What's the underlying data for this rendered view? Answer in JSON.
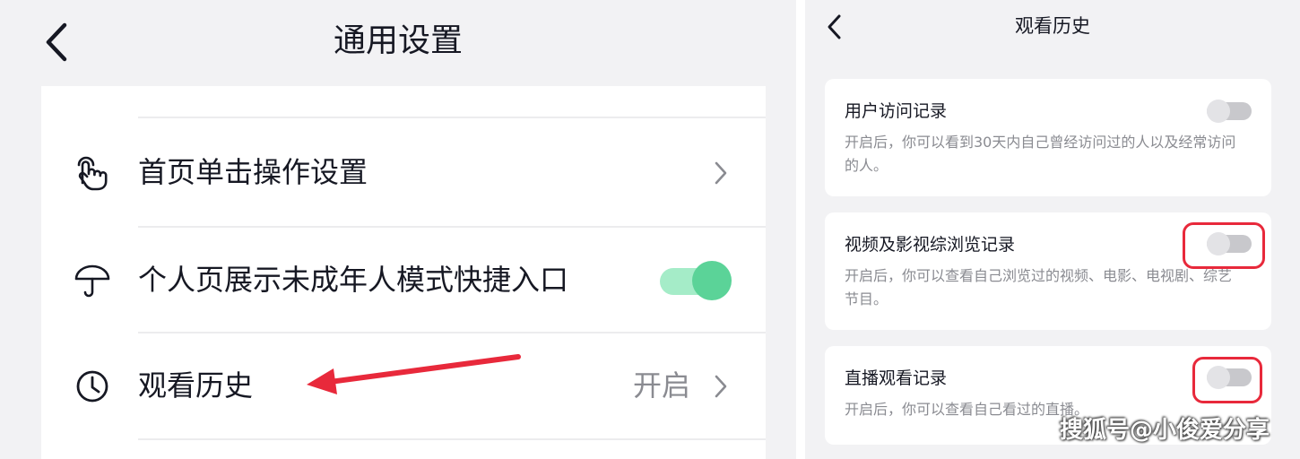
{
  "left": {
    "title": "通用设置",
    "rows": [
      {
        "label": "首页单击操作设置",
        "icon": "tap-hand-icon"
      },
      {
        "label": "个人页展示未成年人模式快捷入口",
        "icon": "umbrella-icon",
        "toggle_on": true
      },
      {
        "label": "观看历史",
        "icon": "clock-icon",
        "value": "开启"
      }
    ]
  },
  "right": {
    "title": "观看历史",
    "settings": [
      {
        "title": "用户访问记录",
        "desc": "开启后，你可以看到30天内自己曾经访问过的人以及经常访问的人。",
        "enabled": false
      },
      {
        "title": "视频及影视综浏览记录",
        "desc": "开启后，你可以查看自己浏览过的视频、电影、电视剧、综艺节目。",
        "enabled": false
      },
      {
        "title": "直播观看记录",
        "desc": "开启后，你可以查看自己看过的直播。",
        "enabled": false
      }
    ]
  },
  "watermark": "搜狐号@小俊爱分享",
  "colors": {
    "toggle_on": "#5bd398",
    "toggle_off": "#c8c8cc",
    "annotation": "#e8293b",
    "background": "#f2f2f4"
  }
}
